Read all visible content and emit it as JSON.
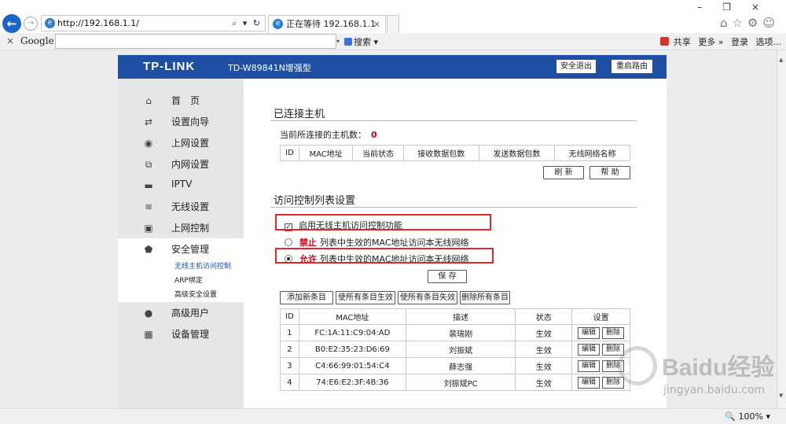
{
  "browser": {
    "url": "http://192.168.1.1/",
    "addr_controls": "⌕ ▾ ↻",
    "tab_title": "正在等待 192.168.1.1",
    "google_label": "Google",
    "search_button": "搜索",
    "toolbar_share": "共享",
    "toolbar_more": "更多 »",
    "toolbar_login": "登录",
    "toolbar_options": "选项...",
    "zoom": "100%"
  },
  "router": {
    "logo": "TP-LINK",
    "model": "TD-W89841N增强型",
    "logout": "安全退出",
    "reboot": "重启路由"
  },
  "menu": [
    {
      "label": "首　页",
      "icon": "home-icon",
      "glyph": "⌂"
    },
    {
      "label": "设置向导",
      "icon": "wizard-icon",
      "glyph": "⇄"
    },
    {
      "label": "上网设置",
      "icon": "globe-icon",
      "glyph": "◉"
    },
    {
      "label": "内网设置",
      "icon": "network-icon",
      "glyph": "⧉"
    },
    {
      "label": "IPTV",
      "icon": "tv-icon",
      "glyph": "▬"
    },
    {
      "label": "无线设置",
      "icon": "wifi-icon",
      "glyph": "≋"
    },
    {
      "label": "上网控制",
      "icon": "lock-icon",
      "glyph": "▣"
    },
    {
      "label": "安全管理",
      "icon": "shield-icon",
      "glyph": "⬟"
    },
    {
      "label": "高级用户",
      "icon": "user-icon",
      "glyph": "●"
    },
    {
      "label": "设备管理",
      "icon": "grid-icon",
      "glyph": "▦"
    }
  ],
  "submenu": [
    "无线主机访问控制",
    "ARP绑定",
    "高级安全设置"
  ],
  "connected": {
    "title": "已连接主机",
    "count_label": "当前所连接的主机数：",
    "count": "0",
    "headers": [
      "ID",
      "MAC地址",
      "当前状态",
      "接收数据包数",
      "发送数据包数",
      "无线网络名称"
    ],
    "refresh": "刷 新",
    "help": "帮 助"
  },
  "acl": {
    "title": "访问控制列表设置",
    "enable_label": "启用无线主机访问控制功能",
    "enable_mark": "✓",
    "deny_kw": "禁止",
    "deny_text": "列表中生效的MAC地址访问本无线网络",
    "allow_kw": "允许",
    "allow_text": "列表中生效的MAC地址访问本无线网络",
    "save": "保 存",
    "actions": [
      "添加新条目",
      "使所有条目生效",
      "使所有条目失效",
      "删除所有条目"
    ],
    "headers": [
      "ID",
      "MAC地址",
      "描述",
      "状态",
      "设置"
    ],
    "edit": "编辑",
    "delete": "删除",
    "rows": [
      {
        "id": "1",
        "mac": "FC:1A:11:C9:04:AD",
        "desc": "裴瑞刚",
        "status": "生效"
      },
      {
        "id": "2",
        "mac": "B0:E2:35:23:D6:69",
        "desc": "刘振斌",
        "status": "生效"
      },
      {
        "id": "3",
        "mac": "C4:66:99:01:54:C4",
        "desc": "薛志强",
        "status": "生效"
      },
      {
        "id": "4",
        "mac": "74:E6:E2:3F:4B:36",
        "desc": "刘振斌PC",
        "status": "生效"
      }
    ]
  },
  "watermark": {
    "brand": "Baidu经验",
    "domain": "jingyan.baidu.com"
  }
}
